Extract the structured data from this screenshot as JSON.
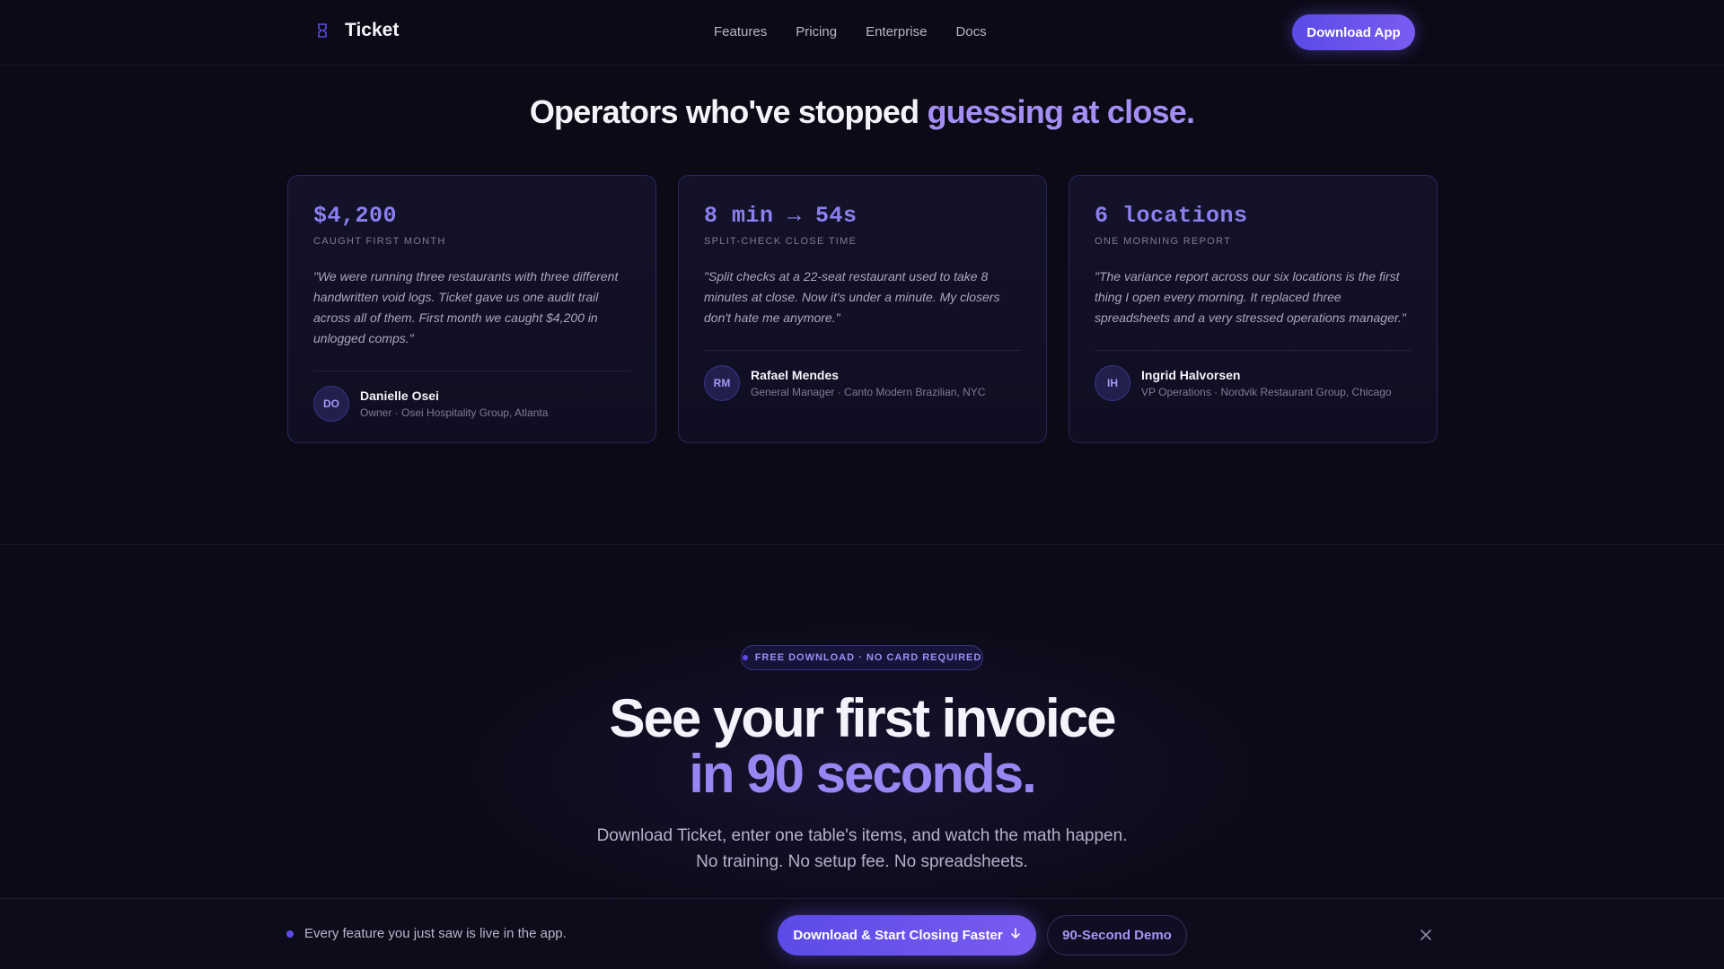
{
  "nav": {
    "brand": "Ticket",
    "links": [
      "Features",
      "Pricing",
      "Enterprise",
      "Docs"
    ],
    "cta": "Download App"
  },
  "testimonials": {
    "title_main": "Operators who've stopped ",
    "title_accent": "guessing at close.",
    "cards": [
      {
        "metric": "$4,200",
        "metric_label": "CAUGHT FIRST MONTH",
        "quote": "\"We were running three restaurants with three different handwritten void logs. Ticket gave us one audit trail across all of them. First month we caught $4,200 in unlogged comps.\"",
        "initials": "DO",
        "name": "Danielle Osei",
        "role": "Owner · Osei Hospitality Group, Atlanta"
      },
      {
        "metric": "8 min → 54s",
        "metric_label": "SPLIT-CHECK CLOSE TIME",
        "quote": "\"Split checks at a 22-seat restaurant used to take 8 minutes at close. Now it's under a minute. My closers don't hate me anymore.\"",
        "initials": "RM",
        "name": "Rafael Mendes",
        "role": "General Manager · Canto Modern Brazilian, NYC"
      },
      {
        "metric": "6 locations",
        "metric_label": "ONE MORNING REPORT",
        "quote": "\"The variance report across our six locations is the first thing I open every morning. It replaced three spreadsheets and a very stressed operations manager.\"",
        "initials": "IH",
        "name": "Ingrid Halvorsen",
        "role": "VP Operations · Nordvik Restaurant Group, Chicago"
      }
    ]
  },
  "cta": {
    "pill": "FREE DOWNLOAD · NO CARD REQUIRED",
    "title_line1": "See your first invoice",
    "title_line2": "in 90 seconds.",
    "sub_line1": "Download Ticket, enter one table's items, and watch the math happen.",
    "sub_line2": "No training. No setup fee. No spreadsheets."
  },
  "sticky_bar": {
    "message": "Every feature you just saw is live in the app.",
    "primary": "Download & Start Closing Faster",
    "secondary": "90-Second Demo"
  },
  "colors": {
    "background": "#0b0a16",
    "accent": "#8d7ff0",
    "button": "#5b4be8"
  },
  "icons": {
    "brand": "ticket-icon",
    "primary_button": "arrow-down-icon",
    "close": "close-icon"
  }
}
